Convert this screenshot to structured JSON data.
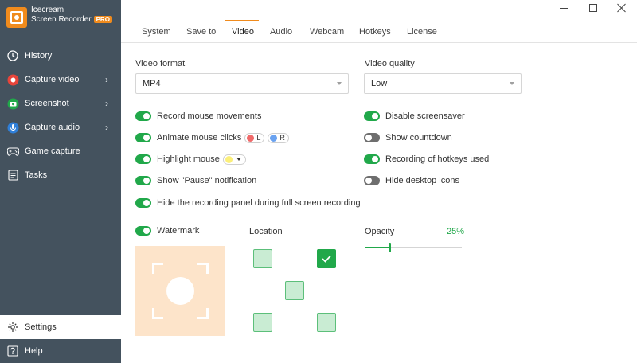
{
  "app": {
    "name_line1": "Icecream",
    "name_line2": "Screen Recorder",
    "badge": "PRO"
  },
  "sidebar": {
    "items": [
      {
        "label": "History",
        "icon": "clock-icon"
      },
      {
        "label": "Capture video",
        "icon": "record-icon",
        "color": "#e8443a"
      },
      {
        "label": "Screenshot",
        "icon": "camera-icon",
        "color": "#21a84a"
      },
      {
        "label": "Capture audio",
        "icon": "microphone-icon",
        "color": "#2f7fd8"
      },
      {
        "label": "Game capture",
        "icon": "gamepad-icon"
      },
      {
        "label": "Tasks",
        "icon": "tasks-icon"
      }
    ],
    "settings": "Settings",
    "help": "Help"
  },
  "tabs": [
    "System",
    "Save to",
    "Video",
    "Audio",
    "Webcam",
    "Hotkeys",
    "License"
  ],
  "active_tab": "Video",
  "video": {
    "format_label": "Video format",
    "format_value": "MP4",
    "quality_label": "Video quality",
    "quality_value": "Low"
  },
  "options_left": {
    "record_mouse": "Record mouse movements",
    "animate_clicks": "Animate mouse clicks",
    "click_left": "L",
    "click_right": "R",
    "highlight_mouse": "Highlight mouse",
    "pause_notification": "Show \"Pause\" notification",
    "hide_panel": "Hide the recording panel during full screen recording"
  },
  "options_right": {
    "disable_screensaver": "Disable screensaver",
    "show_countdown": "Show countdown",
    "recording_hotkeys": "Recording of hotkeys used",
    "hide_desktop_icons": "Hide desktop icons"
  },
  "watermark": {
    "label": "Watermark",
    "location_label": "Location",
    "opacity_label": "Opacity",
    "opacity_value": "25%",
    "opacity_fraction": 0.25
  },
  "colors": {
    "accent": "#f08b1d",
    "toggle_on": "#21a84a",
    "toggle_off": "#6e6e6e",
    "sidebar": "#44525e"
  }
}
